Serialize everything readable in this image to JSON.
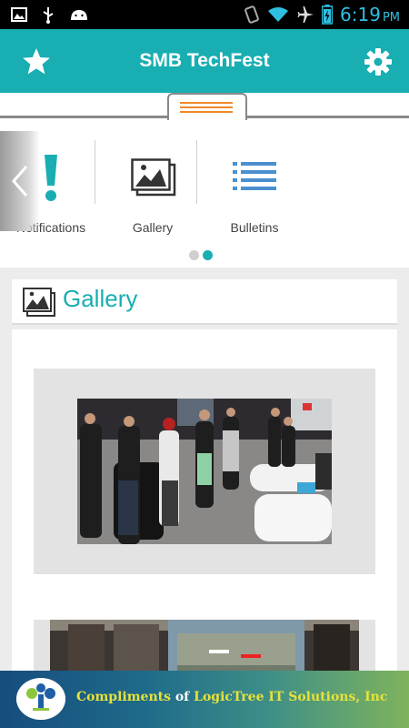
{
  "status_bar": {
    "time": "6:19",
    "ampm": "PM",
    "icons": [
      "image-icon",
      "usb-icon",
      "android-icon",
      "vibrate-icon",
      "wifi-icon",
      "airplane-icon",
      "battery-charging-icon"
    ]
  },
  "app_bar": {
    "title": "SMB TechFest",
    "left_icon": "star-icon",
    "right_icon": "gear-icon",
    "color": "#18aeb2"
  },
  "carousel": {
    "items": [
      {
        "label": "Notifications",
        "icon": "exclamation-icon"
      },
      {
        "label": "Gallery",
        "icon": "gallery-icon"
      },
      {
        "label": "Bulletins",
        "icon": "list-icon"
      }
    ],
    "page_count": 2,
    "active_page": 2
  },
  "gallery": {
    "title": "Gallery"
  },
  "footer": {
    "part1": "Compliments",
    "part2": "of",
    "part3": "LogicTree IT Solutions, Inc"
  }
}
